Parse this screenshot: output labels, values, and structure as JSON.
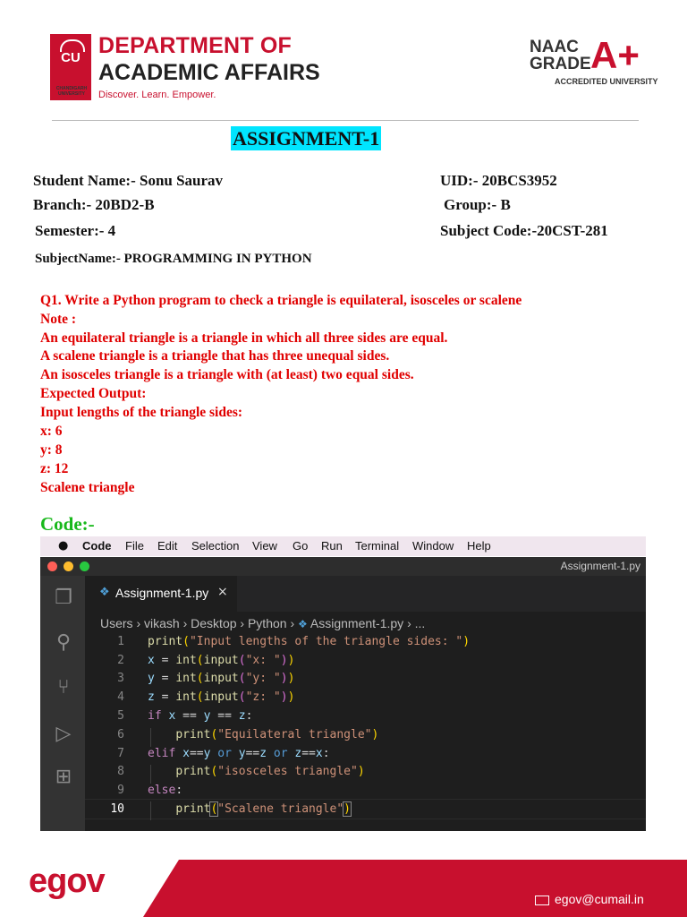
{
  "header": {
    "logo_text": "CU",
    "logo_sub": "CHANDIGARH UNIVERSITY",
    "dept_line1": "DEPARTMENT OF",
    "dept_line2": "ACADEMIC AFFAIRS",
    "tagline": "Discover. Learn. Empower.",
    "naac": "NAAC",
    "grade": "GRADE",
    "grade_value": "A+",
    "accredited": "ACCREDITED UNIVERSITY"
  },
  "title": "ASSIGNMENT-1",
  "student": {
    "name": "Student Name:- Sonu Saurav",
    "uid": "UID:- 20BCS3952",
    "branch": "Branch:- 20BD2-B",
    "group": "Group:- B",
    "semester": "Semester:- 4",
    "subject_code": "Subject Code:-20CST-281",
    "subject_name": "SubjectName:- PROGRAMMING IN PYTHON"
  },
  "question": {
    "lines": [
      "Q1. Write a Python program to check a triangle is equilateral, isosceles or scalene",
      "Note :",
      "An equilateral triangle is a triangle in which all three sides are equal.",
      "A scalene triangle is a triangle that has three unequal sides.",
      "An isosceles triangle is a triangle with (at least) two equal sides.",
      "Expected Output:",
      "Input lengths of the triangle sides:",
      "x: 6",
      "y: 8",
      "z: 12",
      "Scalene triangle"
    ]
  },
  "code_label": "Code:-",
  "menubar": {
    "apple": "",
    "items": [
      "Code",
      "File",
      "Edit",
      "Selection",
      "View",
      "Go",
      "Run",
      "Terminal",
      "Window",
      "Help"
    ]
  },
  "editor": {
    "window_title": "Assignment-1.py",
    "tab_label": "Assignment-1.py",
    "tab_close": "×",
    "breadcrumb": [
      "Users",
      "vikash",
      "Desktop",
      "Python",
      "Assignment-1.py",
      "..."
    ],
    "line_numbers": [
      "1",
      "2",
      "3",
      "4",
      "5",
      "6",
      "7",
      "8",
      "9",
      "10"
    ],
    "activity_icons": [
      "files-icon",
      "search-icon",
      "source-control-icon",
      "run-debug-icon",
      "extensions-icon"
    ]
  },
  "footer": {
    "brand": "egov",
    "email": "egov@cumail.in"
  },
  "colors": {
    "brand_red": "#c8102e",
    "title_highlight": "#00e5ff",
    "question_red": "#e00000",
    "code_label_green": "#17b81a",
    "editor_bg": "#1e1e1e"
  }
}
